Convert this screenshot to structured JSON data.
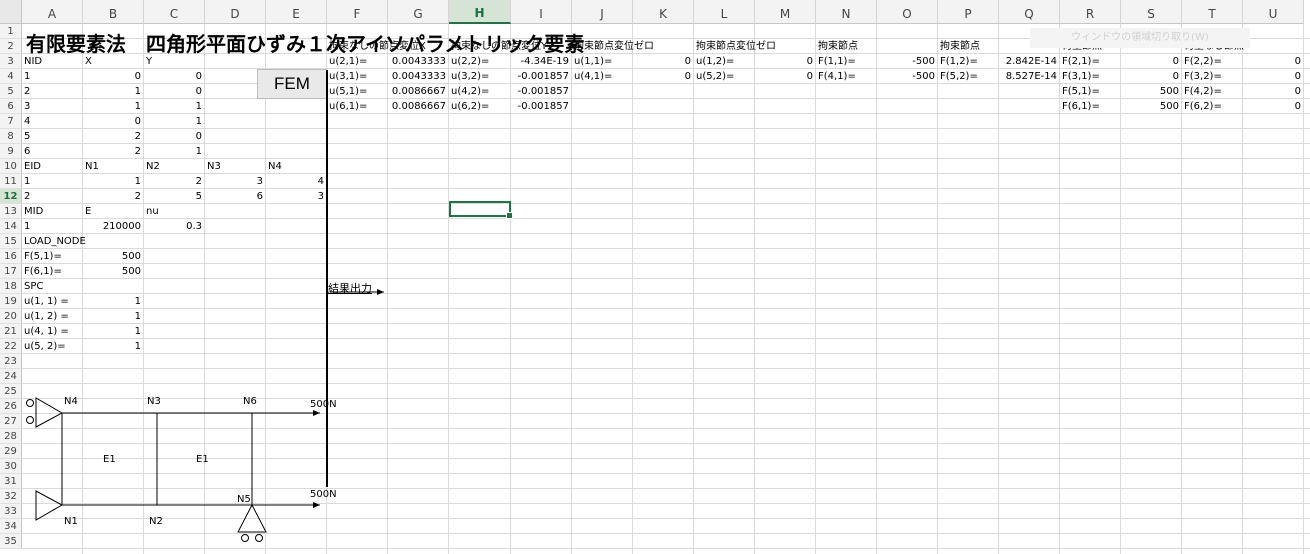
{
  "columns": [
    "A",
    "B",
    "C",
    "D",
    "E",
    "F",
    "G",
    "H",
    "I",
    "J",
    "K",
    "L",
    "M",
    "N",
    "O",
    "P",
    "Q",
    "R",
    "S",
    "T",
    "U"
  ],
  "rows": [
    "1",
    "2",
    "3",
    "4",
    "5",
    "6",
    "7",
    "8",
    "9",
    "10",
    "11",
    "12",
    "13",
    "14",
    "15",
    "16",
    "17",
    "18",
    "19",
    "20",
    "21",
    "22",
    "23",
    "24",
    "25",
    "26",
    "27",
    "28",
    "29",
    "30",
    "31",
    "32",
    "33",
    "34",
    "35"
  ],
  "selected_cell": "H12",
  "title": "有限要素法　四角形平面ひずみ１次アイソパラメトリック要素",
  "fem_button": "FEM",
  "hidden_button": "ウィンドウの領域切り取り(W)",
  "result_label": "結果出力",
  "cells": {
    "A3": "NID",
    "B3": "X",
    "C3": "Y",
    "A4": "1",
    "B4": "0",
    "C4": "0",
    "A5": "2",
    "B5": "1",
    "C5": "0",
    "A6": "3",
    "B6": "1",
    "C6": "1",
    "A7": "4",
    "B7": "0",
    "C7": "1",
    "A8": "5",
    "B8": "2",
    "C8": "0",
    "A9": "6",
    "B9": "2",
    "C9": "1",
    "A10": "EID",
    "B10": "N1",
    "C10": "N2",
    "D10": "N3",
    "E10": "N4",
    "A11": "1",
    "B11": "1",
    "C11": "2",
    "D11": "3",
    "E11": "4",
    "A12": "2",
    "B12": "2",
    "C12": "5",
    "D12": "6",
    "E12": "3",
    "A13": "MID",
    "B13": "E",
    "C13": "nu",
    "A14": "1",
    "B14": "210000",
    "C14": "0.3",
    "A15": "LOAD_NODE",
    "A16": "F(5,1)=",
    "B16": "500",
    "A17": "F(6,1)=",
    "B17": "500",
    "A18": "SPC",
    "A19": "u(1, 1) =",
    "B19": "1",
    "A20": "u(1, 2) =",
    "B20": "1",
    "A21": "u(4, 1) =",
    "B21": "1",
    "A22": "u(5, 2)=",
    "B22": "1",
    "F2": "拘束なしの節点変位X",
    "H2": "拘束なしの節点変位Y",
    "J2": "拘束節点変位ゼロ",
    "L2": "拘束節点変位ゼロ",
    "N2": "拘束節点",
    "P2": "拘束節点",
    "R2": "荷重節点",
    "T2": "荷重なし節点",
    "F3": "u(2,1)=",
    "G3": "0.0043333",
    "H3": "u(2,2)=",
    "I3": "-4.34E-19",
    "J3": "u(1,1)=",
    "K3": "0",
    "L3": "u(1,2)=",
    "M3": "0",
    "N3": "F(1,1)=",
    "O3": "-500",
    "P3": "F(1,2)=",
    "Q3": "2.842E-14",
    "R3": "F(2,1)=",
    "S3": "0",
    "T3": "F(2,2)=",
    "U3": "0",
    "F4": "u(3,1)=",
    "G4": "0.0043333",
    "H4": "u(3,2)=",
    "I4": "-0.001857",
    "J4": "u(4,1)=",
    "K4": "0",
    "L4": "u(5,2)=",
    "M4": "0",
    "N4": "F(4,1)=",
    "O4": "-500",
    "P4": "F(5,2)=",
    "Q4": "8.527E-14",
    "R4": "F(3,1)=",
    "S4": "0",
    "T4": "F(3,2)=",
    "U4": "0",
    "F5": "u(5,1)=",
    "G5": "0.0086667",
    "H5": "u(4,2)=",
    "I5": "-0.001857",
    "R5": "F(5,1)=",
    "S5": "500",
    "T5": "F(4,2)=",
    "U5": "0",
    "F6": "u(6,1)=",
    "G6": "0.0086667",
    "H6": "u(6,2)=",
    "I6": "-0.001857",
    "R6": "F(6,1)=",
    "S6": "500",
    "T6": "F(6,2)=",
    "U6": "0"
  },
  "diagram": {
    "nodes": {
      "n1": "N1",
      "n2": "N2",
      "n3": "N3",
      "n4": "N4",
      "n5": "N5",
      "n6": "N6"
    },
    "elements": {
      "left": "E1",
      "right": "E1"
    },
    "loads": {
      "top": "500N",
      "bottom": "500N"
    }
  }
}
